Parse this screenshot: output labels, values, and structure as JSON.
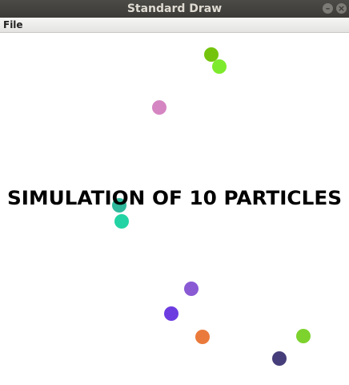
{
  "window": {
    "title": "Standard Draw",
    "minimize_glyph": "–",
    "close_glyph": "×"
  },
  "menubar": {
    "items": [
      {
        "label": "File"
      }
    ]
  },
  "canvas": {
    "headline": "SIMULATION OF 10 PARTICLES",
    "background": "#ffffff",
    "particles": [
      {
        "color": "#74c40d"
      },
      {
        "color": "#7dea2c"
      },
      {
        "color": "#d585c2"
      },
      {
        "color": "#2fb89b"
      },
      {
        "color": "#22d3a3"
      },
      {
        "color": "#8a5ad4"
      },
      {
        "color": "#6c3ce0"
      },
      {
        "color": "#ea7a3b"
      },
      {
        "color": "#7dd22e"
      },
      {
        "color": "#463e7a"
      }
    ]
  }
}
